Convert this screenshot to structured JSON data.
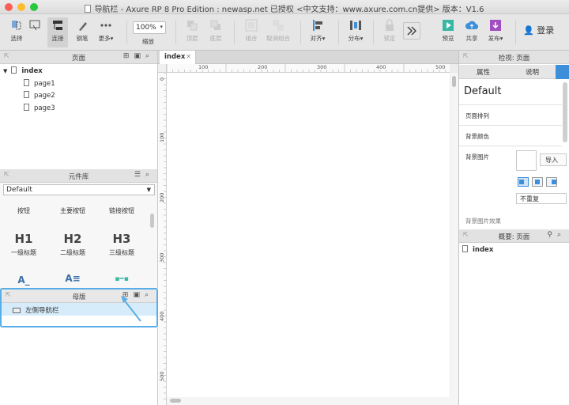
{
  "window": {
    "title": "导航栏 - Axure RP 8 Pro Edition : newasp.net 已授权    <中文支持：www.axure.com.cn提供> 版本：V1.6"
  },
  "toolbar": {
    "select": "选择",
    "connect": "连接",
    "pen": "钢笔",
    "more": "更多▾",
    "zoom_value": "100%",
    "zoom_label": "缩放",
    "top": "顶层",
    "bottom": "底层",
    "group": "组合",
    "ungroup": "取消组合",
    "align": "对齐▾",
    "distribute": "分布▾",
    "lock": "锁定",
    "preview": "预览",
    "share": "共享",
    "publish": "发布▾",
    "login": "登录"
  },
  "pages_panel": {
    "title": "页面",
    "root": "index",
    "pages": [
      "page1",
      "page2",
      "page3"
    ]
  },
  "library_panel": {
    "title": "元件库",
    "selected": "Default",
    "widgets_row1": [
      "按钮",
      "主要按钮",
      "链接按钮"
    ],
    "widgets_row2": [
      {
        "glyph": "H1",
        "label": "一级标题"
      },
      {
        "glyph": "H2",
        "label": "二级标题"
      },
      {
        "glyph": "H3",
        "label": "三级标题"
      }
    ],
    "widgets_row3": [
      "A_",
      "A≡",
      "▪━▪"
    ]
  },
  "masters_panel": {
    "title": "母版",
    "items": [
      "左侧导航栏"
    ]
  },
  "canvas": {
    "tab": "index",
    "tab_close": "×",
    "h_ticks": [
      "100",
      "200",
      "300",
      "400",
      "500"
    ],
    "v_ticks": [
      "0",
      "100",
      "200",
      "300",
      "400",
      "500"
    ]
  },
  "inspector": {
    "title": "检视: 页面",
    "tab_props": "属性",
    "tab_notes": "说明",
    "style_name": "Default",
    "page_align": "页面排列",
    "bg_color": "背景颜色",
    "bg_image": "背景图片",
    "import": "导入",
    "repeat": "不重复",
    "cut_label": "背景图片效果"
  },
  "outline": {
    "title": "概要: 页面",
    "root": "index"
  },
  "colors": {
    "accent": "#3d8fd9",
    "highlight": "#5aaee8"
  }
}
